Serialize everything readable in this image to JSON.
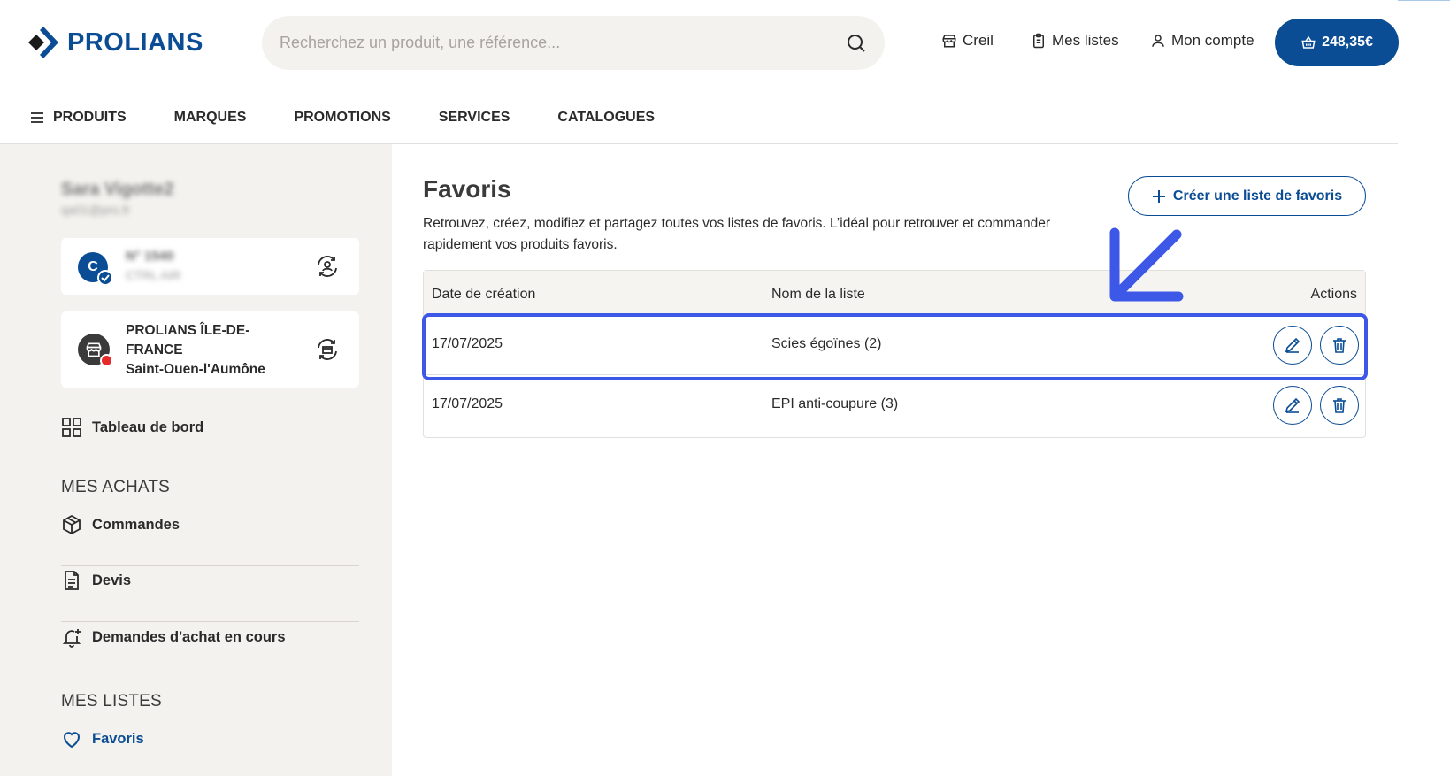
{
  "header": {
    "logo_text": "PROLIANS",
    "search_placeholder": "Recherchez un produit, une référence...",
    "store_label": "Creil",
    "lists_label": "Mes listes",
    "account_label": "Mon compte",
    "cart_total": "248,35€"
  },
  "nav": {
    "items": [
      "PRODUITS",
      "MARQUES",
      "PROMOTIONS",
      "SERVICES",
      "CATALOGUES"
    ]
  },
  "sidebar": {
    "user_name": "Sara Vigotte2",
    "user_email": "qa01@pro.fr",
    "account_card": {
      "avatar_letter": "C",
      "number": "N° 1540",
      "sub": "CTRL AIR"
    },
    "store_card": {
      "line1": "PROLIANS ÎLE-DE-FRANCE",
      "line2": "Saint-Ouen-l'Aumône"
    },
    "dashboard_label": "Tableau de bord",
    "section_purchases": "MES ACHATS",
    "orders_label": "Commandes",
    "quotes_label": "Devis",
    "requests_label": "Demandes d'achat en cours",
    "section_lists": "MES LISTES",
    "favorites_label": "Favoris"
  },
  "main": {
    "title": "Favoris",
    "description": "Retrouvez, créez, modifiez et partagez toutes vos listes de favoris. L’idéal pour retrouver et commander rapidement vos produits favoris.",
    "create_button": "Créer une liste de favoris",
    "columns": {
      "date": "Date de création",
      "name": "Nom de la liste",
      "actions": "Actions"
    },
    "rows": [
      {
        "date": "17/07/2025",
        "name": "Scies égoïnes (2)"
      },
      {
        "date": "17/07/2025",
        "name": "EPI anti-coupure (3)"
      }
    ]
  },
  "colors": {
    "brand_blue": "#0a4d94",
    "annotation": "#3d57e6",
    "sidebar_bg": "#f4f2ee"
  }
}
